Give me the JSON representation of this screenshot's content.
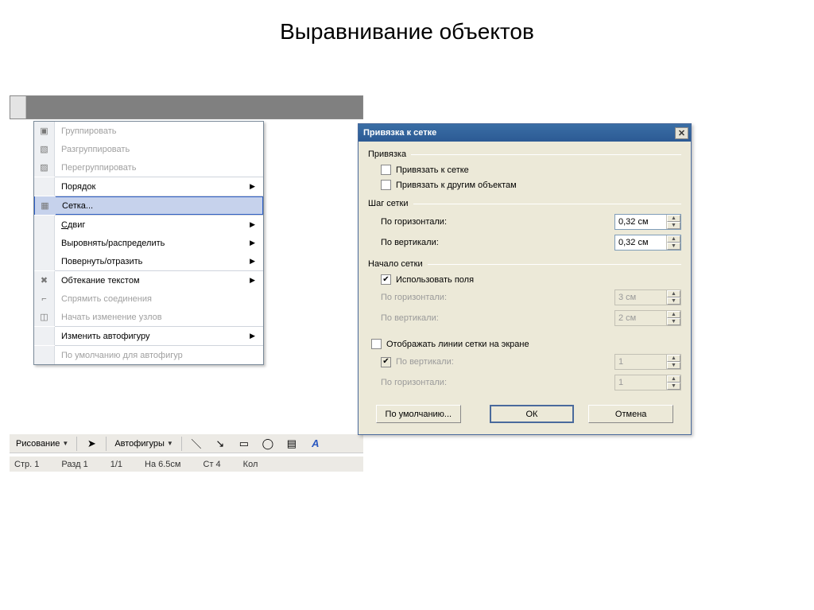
{
  "title": "Выравнивание объектов",
  "menu": {
    "items": [
      {
        "label": "Группировать",
        "disabled": true,
        "icon": "group-icon",
        "arrow": false
      },
      {
        "label": "Разгруппировать",
        "disabled": true,
        "icon": "ungroup-icon",
        "arrow": false
      },
      {
        "label": "Перегруппировать",
        "disabled": true,
        "icon": "regroup-icon",
        "arrow": false
      },
      {
        "sep": true
      },
      {
        "label": "Порядок",
        "disabled": false,
        "arrow": true
      },
      {
        "sep": true
      },
      {
        "label": "Сетка...",
        "disabled": false,
        "icon": "grid-icon",
        "selected": true
      },
      {
        "sep": true
      },
      {
        "label": "Сдвиг",
        "disabled": false,
        "arrow": true
      },
      {
        "label": "Выровнять/распределить",
        "disabled": false,
        "arrow": true
      },
      {
        "label": "Повернуть/отразить",
        "disabled": false,
        "arrow": true
      },
      {
        "sep": true
      },
      {
        "label": "Обтекание текстом",
        "disabled": false,
        "icon": "wrap-icon",
        "arrow": true
      },
      {
        "label": "Спрямить соединения",
        "disabled": true
      },
      {
        "label": "Начать изменение узлов",
        "disabled": true,
        "icon": "edit-nodes-icon"
      },
      {
        "sep": true
      },
      {
        "label": "Изменить автофигуру",
        "disabled": false,
        "arrow": true
      },
      {
        "sep": true
      },
      {
        "label": "По умолчанию для автофигур",
        "disabled": true
      }
    ]
  },
  "toolbar": {
    "draw": "Рисование",
    "autoshapes": "Автофигуры"
  },
  "statusbar": {
    "page": "Стр. 1",
    "section": "Разд 1",
    "pages": "1/1",
    "at": "На 6.5см",
    "col": "Ст 4",
    "col2": "Кол"
  },
  "dialog": {
    "title": "Привязка к сетке",
    "groups": {
      "snap": {
        "legend": "Привязка",
        "snap_grid": "Привязать к сетке",
        "snap_objects": "Привязать к другим объектам"
      },
      "step": {
        "legend": "Шаг сетки",
        "horiz": "По горизонтали:",
        "vert": "По вертикали:",
        "horiz_val": "0,32 см",
        "vert_val": "0,32 см"
      },
      "origin": {
        "legend": "Начало сетки",
        "use_margins": "Использовать поля",
        "horiz": "По горизонтали:",
        "vert": "По вертикали:",
        "horiz_val": "3 см",
        "vert_val": "2 см"
      },
      "display": {
        "show": "Отображать линии сетки на экране",
        "vert": "По вертикали:",
        "horiz": "По горизонтали:",
        "vert_val": "1",
        "horiz_val": "1"
      }
    },
    "buttons": {
      "default": "По умолчанию...",
      "ok": "ОК",
      "cancel": "Отмена"
    }
  }
}
